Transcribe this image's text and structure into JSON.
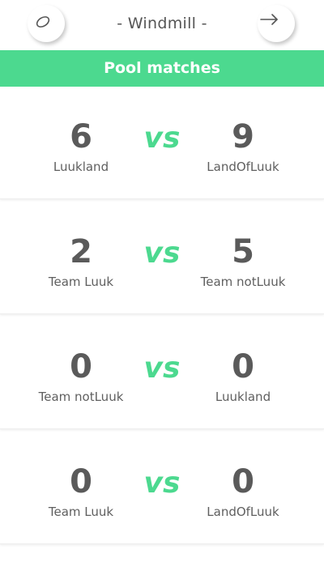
{
  "header": {
    "title": "- Windmill -",
    "left_icon": "disc-icon",
    "right_icon": "arrow-right-icon"
  },
  "banner": {
    "title": "Pool matches"
  },
  "vs_label": "vs",
  "colors": {
    "accent": "#4cd98f",
    "text": "#555555",
    "background": "#ffffff"
  },
  "matches": [
    {
      "home": {
        "name": "Luukland",
        "score": "6"
      },
      "away": {
        "name": "LandOfLuuk",
        "score": "9"
      }
    },
    {
      "home": {
        "name": "Team Luuk",
        "score": "2"
      },
      "away": {
        "name": "Team notLuuk",
        "score": "5"
      }
    },
    {
      "home": {
        "name": "Team notLuuk",
        "score": "0"
      },
      "away": {
        "name": "Luukland",
        "score": "0"
      }
    },
    {
      "home": {
        "name": "Team Luuk",
        "score": "0"
      },
      "away": {
        "name": "LandOfLuuk",
        "score": "0"
      }
    }
  ]
}
